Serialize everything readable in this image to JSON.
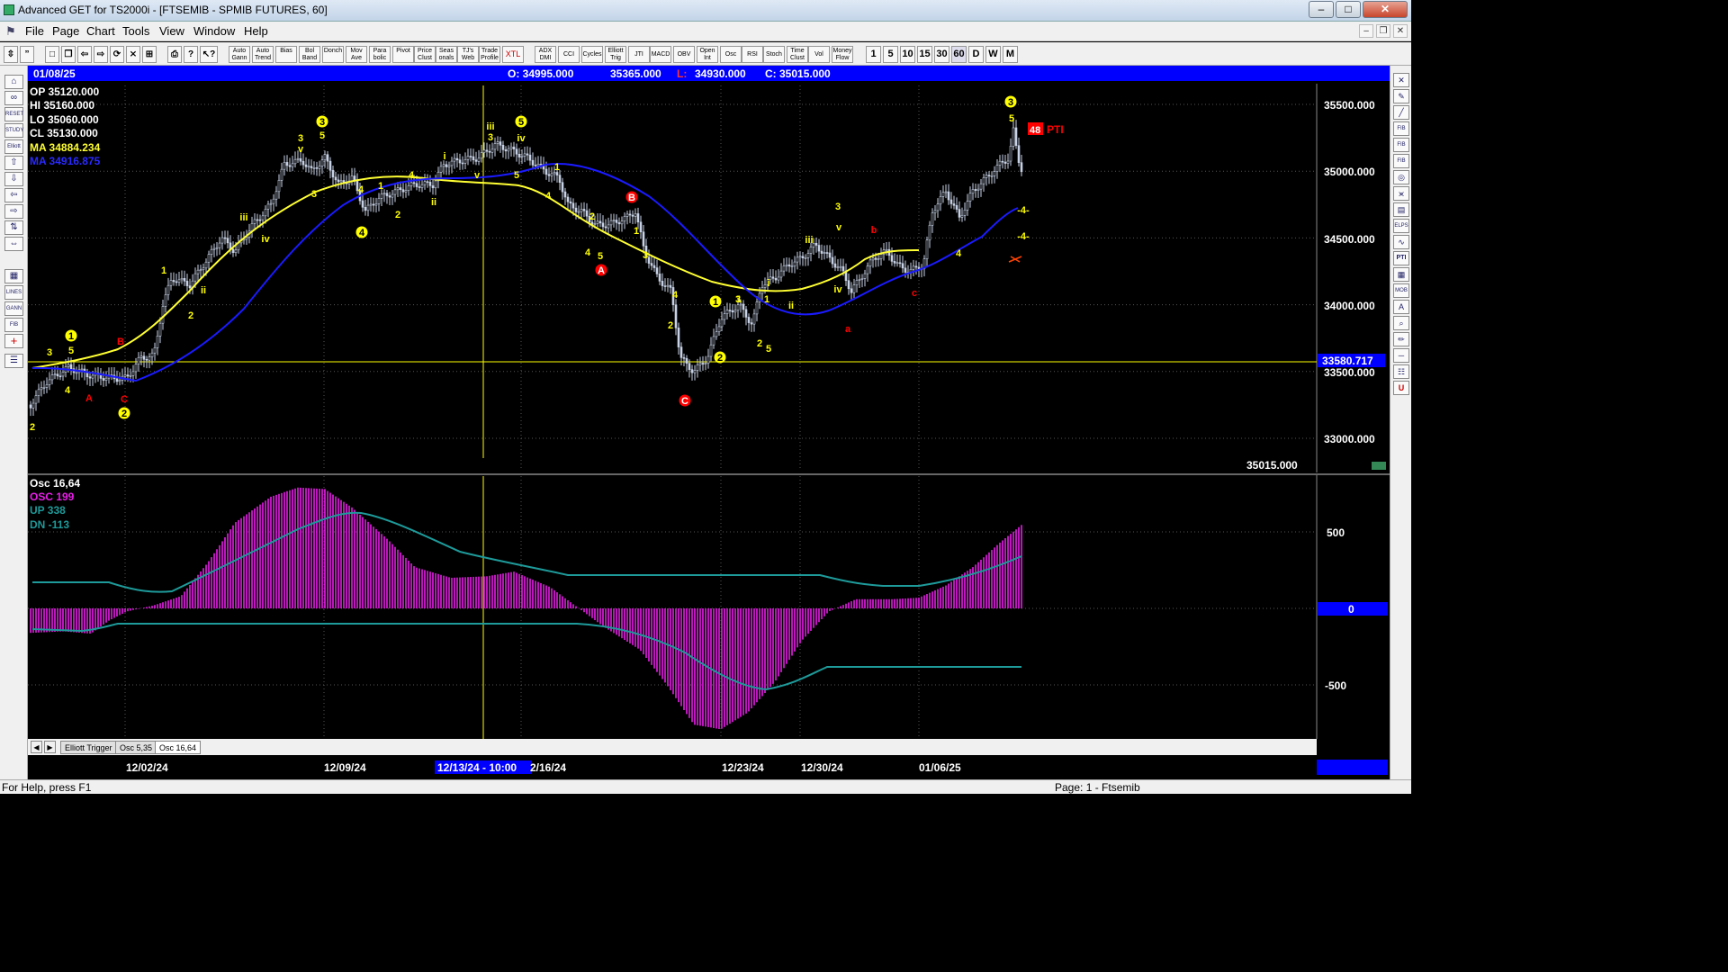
{
  "window": {
    "title": "Advanced GET for TS2000i - [FTSEMIB - SPMIB FUTURES, 60]",
    "minimize": "–",
    "maximize": "□",
    "close": "✕"
  },
  "menu": [
    "File",
    "Page",
    "Chart",
    "Tools",
    "View",
    "Window",
    "Help"
  ],
  "toolbar": {
    "indicator_buttons": [
      "Auto Gann",
      "Auto Trend",
      "Bias",
      "Bol Band",
      "Donch",
      "Mov Ave",
      "Para bolic",
      "Pivot",
      "Price Clust",
      "Seas onals",
      "TJ's Web",
      "Trade Profile",
      "XTL",
      "ADX DMI",
      "CCI",
      "Cycles",
      "Elliott Trig",
      "JTI",
      "MACD",
      "OBV",
      "Open Int",
      "Osc",
      "RSI",
      "Stoch",
      "Time Clust",
      "Vol",
      "Money Flow"
    ],
    "intervals": [
      "1",
      "5",
      "10",
      "15",
      "30",
      "60",
      "D",
      "W",
      "M"
    ]
  },
  "header_bar": {
    "date": "01/08/25",
    "open": "O: 34995.000",
    "high": "35365.000",
    "low_label": "L:",
    "low": "34930.000",
    "close": "C: 35015.000"
  },
  "price_panel": {
    "op": "OP  35120.000",
    "hi": "HI   35160.000",
    "lo": "LO  35060.000",
    "cl": "CL  35130.000",
    "ma1": "MA  34884.234",
    "ma2": "MA  34916.875",
    "axis_labels": [
      "35500.000",
      "35000.000",
      "34500.000",
      "34000.000",
      "33500.000",
      "33000.000"
    ],
    "cursor_price": "33580.717",
    "last_price": "35015.000",
    "pti_value": "48",
    "pti_label": "PTI"
  },
  "osc_panel": {
    "name": "Osc 16,64",
    "osc": "OSC 199",
    "up": "UP   338",
    "dn": "DN   -113",
    "axis_labels": [
      "500",
      "0",
      "-500"
    ]
  },
  "tabs": [
    "Elliott Trigger",
    "Osc 5,35",
    "Osc 16,64"
  ],
  "time_axis": {
    "labels": [
      "12/02/24",
      "12/09/24",
      "12/23/24",
      "12/30/24",
      "01/06/25"
    ],
    "cursor_label": "12/13/24 - 10:00",
    "extra_label": "2/16/24"
  },
  "wave_labels": {
    "yellow": [
      "2",
      "3",
      "5",
      "4",
      "1",
      "2",
      "ii",
      "iii",
      "iv",
      "3",
      "v",
      "5",
      "3",
      "4",
      "1",
      "2",
      "ii",
      "4",
      "i",
      "iii",
      "3",
      "v",
      "iv",
      "5",
      "4",
      "1",
      "2",
      "4",
      "5",
      "1",
      "3",
      "2",
      "4",
      "3",
      "5",
      "1",
      "1",
      "2",
      "i",
      "ii",
      "iii",
      "3",
      "v",
      "iv",
      "4",
      "5",
      "-4-",
      "-4-"
    ],
    "yellow_circled": [
      "1",
      "2",
      "3",
      "4",
      "5",
      "1",
      "2",
      "3"
    ],
    "red": [
      "A",
      "B",
      "C",
      "a",
      "b",
      "c"
    ],
    "red_circled": [
      "A",
      "B",
      "C"
    ]
  },
  "status": {
    "help": "For Help, press F1",
    "page": "Page: 1 - Ftsemib"
  },
  "colors": {
    "wave_yellow": "#ffff00",
    "wave_red": "#ff0000",
    "ma_fast": "#ffff33",
    "ma_slow": "#1a1aff",
    "osc_bars": "#e81ee8",
    "osc_bands": "#1e9a9a",
    "blue_bar": "#0000ff"
  }
}
